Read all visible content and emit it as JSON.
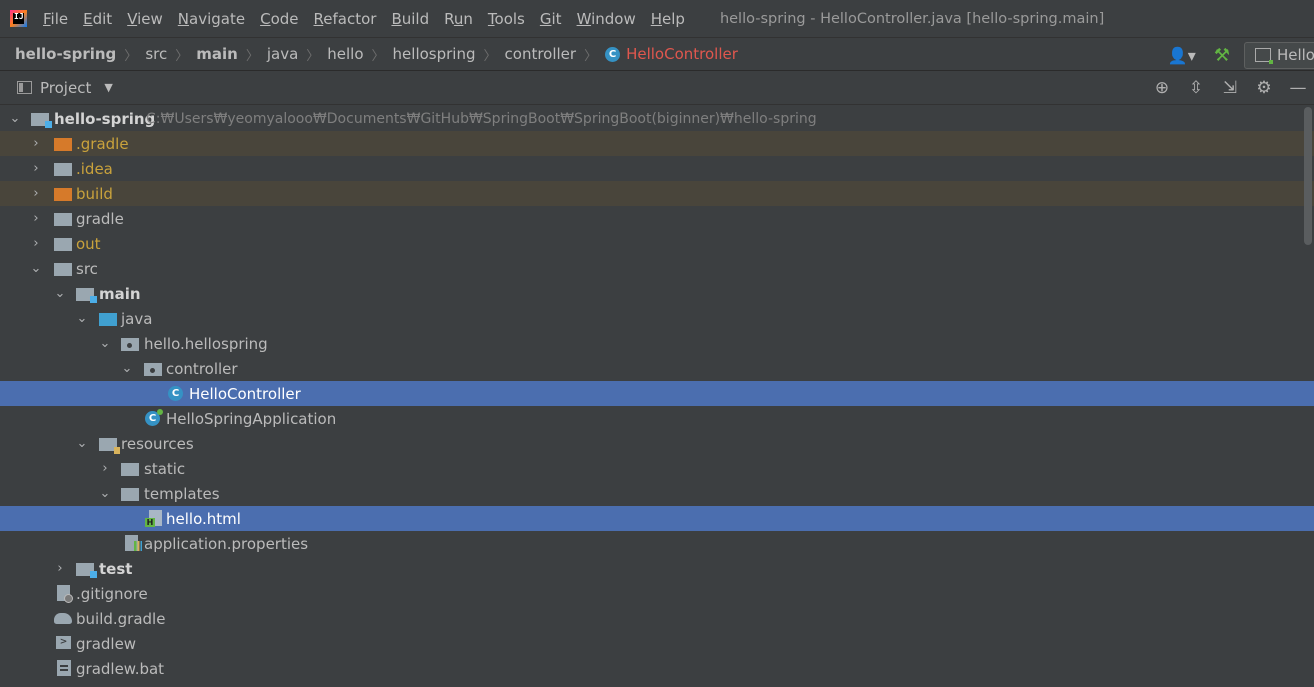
{
  "app": {
    "logo_letters": "IJ",
    "window_title": "hello-spring - HelloController.java [hello-spring.main]"
  },
  "menu": [
    {
      "mnemonic": "F",
      "rest": "ile"
    },
    {
      "mnemonic": "E",
      "rest": "dit"
    },
    {
      "mnemonic": "V",
      "rest": "iew"
    },
    {
      "mnemonic": "N",
      "rest": "avigate"
    },
    {
      "mnemonic": "C",
      "rest": "ode"
    },
    {
      "mnemonic": "R",
      "rest": "efactor"
    },
    {
      "mnemonic": "B",
      "rest": "uild"
    },
    {
      "pre": "R",
      "mnemonic": "u",
      "rest": "n"
    },
    {
      "mnemonic": "T",
      "rest": "ools"
    },
    {
      "mnemonic": "G",
      "rest": "it"
    },
    {
      "mnemonic": "W",
      "rest": "indow"
    },
    {
      "mnemonic": "H",
      "rest": "elp"
    }
  ],
  "breadcrumbs": [
    "hello-spring",
    "src",
    "main",
    "java",
    "hello",
    "hellospring",
    "controller",
    "HelloController"
  ],
  "class_icon_letter": "C",
  "run_config_label": "Hello",
  "project_panel": {
    "title": "Project"
  },
  "tree": {
    "root_label": "hello-spring",
    "root_path": "C:₩Users₩yeomyalooo₩Documents₩GitHub₩SpringBoot₩SpringBoot(biginner)₩hello-spring",
    "rows": [
      {
        "label": ".gradle"
      },
      {
        "label": ".idea"
      },
      {
        "label": "build"
      },
      {
        "label": "gradle"
      },
      {
        "label": "out"
      },
      {
        "label": "src"
      },
      {
        "label": "main"
      },
      {
        "label": "java"
      },
      {
        "label": "hello.hellospring"
      },
      {
        "label": "controller"
      },
      {
        "label": "HelloController"
      },
      {
        "label": "HelloSpringApplication"
      },
      {
        "label": "resources"
      },
      {
        "label": "static"
      },
      {
        "label": "templates"
      },
      {
        "label": "hello.html"
      },
      {
        "label": "application.properties"
      },
      {
        "label": "test"
      },
      {
        "label": ".gitignore"
      },
      {
        "label": "build.gradle"
      },
      {
        "label": "gradlew"
      },
      {
        "label": "gradlew.bat"
      }
    ]
  },
  "colors": {
    "background": "#3c3f41",
    "selection": "#4b6eaf",
    "excluded_row": "#49453b",
    "excluded_text": "#c9a23c",
    "current_file": "#e0574e",
    "class_icon": "#3592c4"
  },
  "icons": [
    "project-view-icon",
    "locate-icon",
    "expand-all-icon",
    "collapse-all-icon",
    "settings-icon",
    "hide-icon",
    "user-icon",
    "build-hammer-icon"
  ]
}
